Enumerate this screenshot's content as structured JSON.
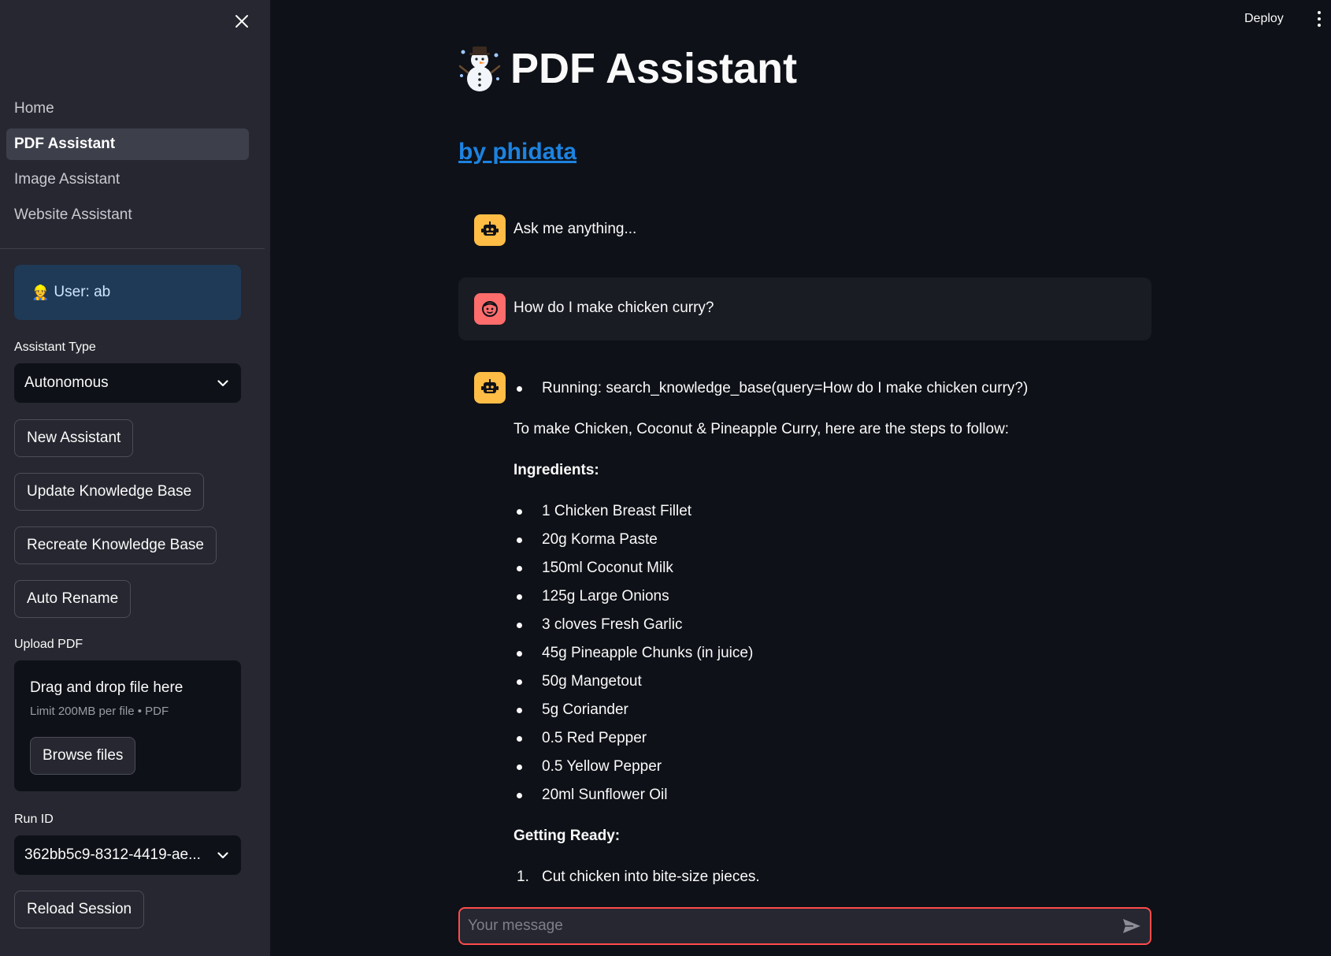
{
  "sidebar": {
    "nav": [
      {
        "label": "Home"
      },
      {
        "label": "PDF Assistant",
        "active": true
      },
      {
        "label": "Image Assistant"
      },
      {
        "label": "Website Assistant"
      }
    ],
    "user_label": "User: ab",
    "assistant_type_label": "Assistant Type",
    "assistant_type_value": "Autonomous",
    "buttons": {
      "new_assistant": "New Assistant",
      "update_kb": "Update Knowledge Base",
      "recreate_kb": "Recreate Knowledge Base",
      "auto_rename": "Auto Rename"
    },
    "upload": {
      "label": "Upload PDF",
      "title": "Drag and drop file here",
      "hint": "Limit 200MB per file • PDF",
      "browse": "Browse files"
    },
    "run_id_label": "Run ID",
    "run_id_value": "362bb5c9-8312-4419-ae...",
    "reload_session": "Reload Session"
  },
  "header": {
    "deploy": "Deploy"
  },
  "main": {
    "title": "PDF Assistant",
    "subtitle": "by phidata",
    "messages": {
      "greeting": "Ask me anything...",
      "user_question": "How do I make chicken curry?",
      "running": "Running: search_knowledge_base(query=How do I make chicken curry?)",
      "intro": "To make Chicken, Coconut & Pineapple Curry, here are the steps to follow:",
      "ingredients_heading": "Ingredients:",
      "ingredients": [
        "1 Chicken Breast Fillet",
        "20g Korma Paste",
        "150ml Coconut Milk",
        "125g Large Onions",
        "3 cloves Fresh Garlic",
        "45g Pineapple Chunks (in juice)",
        "50g Mangetout",
        "5g Coriander",
        "0.5 Red Pepper",
        "0.5 Yellow Pepper",
        "20ml Sunflower Oil"
      ],
      "getting_ready_heading": "Getting Ready:",
      "steps": [
        {
          "num": "1.",
          "text": "Cut chicken into bite-size pieces."
        }
      ]
    },
    "chat_input": {
      "placeholder": "Your message"
    }
  },
  "colors": {
    "accent": "#ff4b4b",
    "link": "#1c83e1",
    "bot_avatar": "#ffbd45",
    "user_avatar": "#ff6c6c",
    "user_box": "#1f3a57"
  }
}
